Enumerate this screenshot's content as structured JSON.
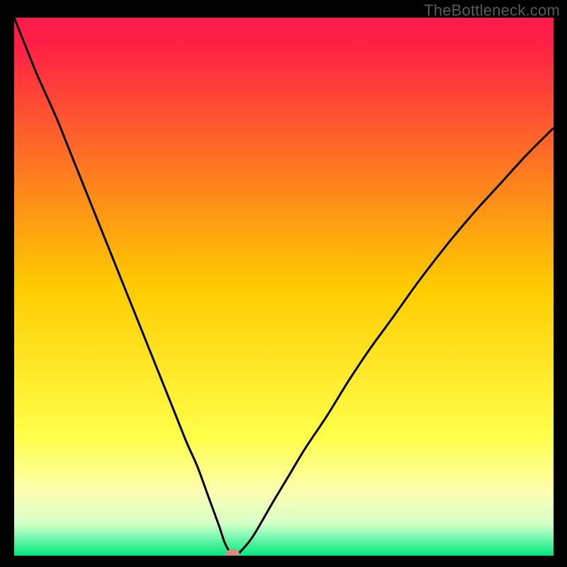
{
  "watermark": "TheBottleneck.com",
  "chart_data": {
    "type": "line",
    "title": "",
    "xlabel": "",
    "ylabel": "",
    "xlim": [
      0,
      100
    ],
    "ylim": [
      0,
      100
    ],
    "background_gradient": {
      "stops": [
        {
          "offset": 0.0,
          "color": "#ff1a49"
        },
        {
          "offset": 0.05,
          "color": "#ff2045"
        },
        {
          "offset": 0.5,
          "color": "#ffcc00"
        },
        {
          "offset": 0.78,
          "color": "#ffff4a"
        },
        {
          "offset": 0.88,
          "color": "#fdffb0"
        },
        {
          "offset": 0.94,
          "color": "#d7ffc8"
        },
        {
          "offset": 0.965,
          "color": "#7cf7b2"
        },
        {
          "offset": 1.0,
          "color": "#00e77a"
        }
      ]
    },
    "series": [
      {
        "name": "bottleneck-curve",
        "x": [
          0,
          2,
          4,
          6,
          8,
          10,
          12,
          14,
          16,
          18,
          20,
          22,
          24,
          26,
          28,
          30,
          32,
          34,
          36,
          38,
          39,
          40,
          41,
          42,
          44,
          46,
          48,
          51,
          54,
          58,
          62,
          66,
          70,
          75,
          80,
          85,
          90,
          95,
          100
        ],
        "y": [
          100,
          95,
          90,
          85.5,
          81,
          76,
          71,
          66,
          61,
          56,
          51,
          46,
          41,
          36,
          31,
          26,
          21,
          16.5,
          11,
          5.5,
          2.5,
          0.7,
          0.1,
          0.8,
          3.2,
          6.5,
          10,
          15,
          20,
          26,
          32.5,
          38.5,
          44,
          51,
          57.5,
          63.5,
          69,
          74.5,
          79.5
        ],
        "color": "#000000",
        "stroke_width": 3
      }
    ],
    "marker": {
      "x": 40.5,
      "y": 0.3,
      "rx": 1.3,
      "ry": 0.9,
      "color": "#d88a7a"
    }
  }
}
